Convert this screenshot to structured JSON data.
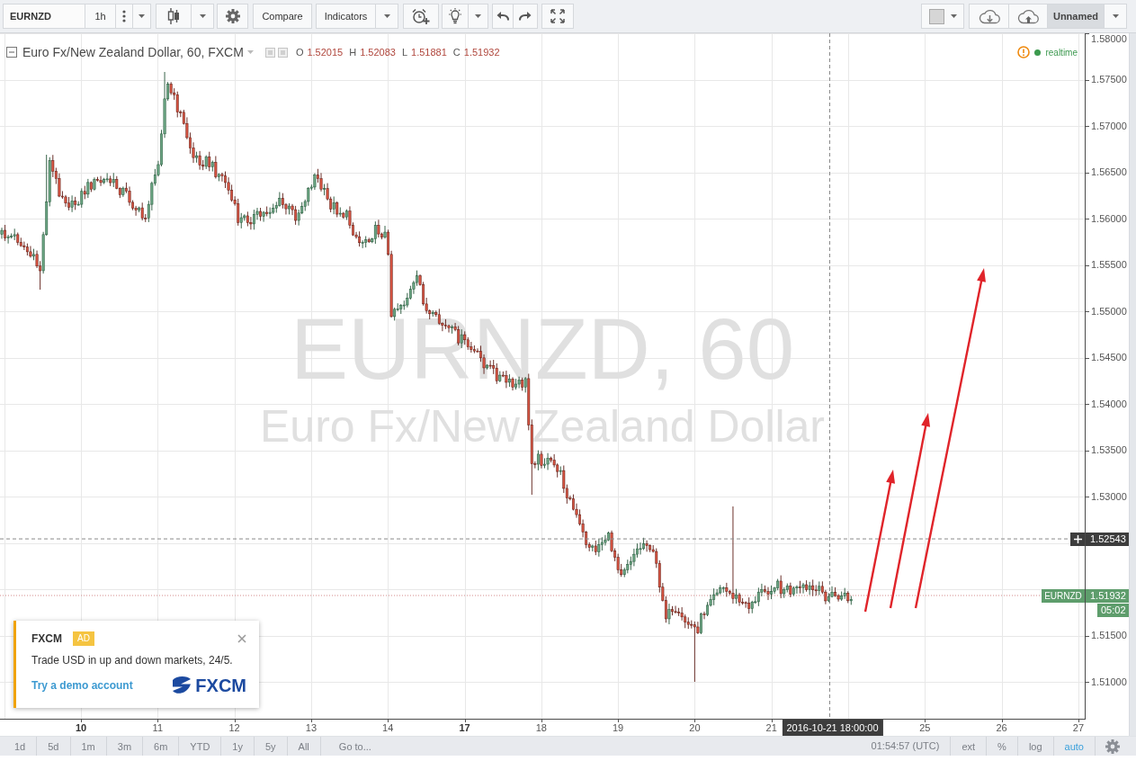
{
  "toolbar": {
    "symbol": "EURNZD",
    "interval": "1h",
    "compare": "Compare",
    "indicators": "Indicators",
    "layout_name": "Unnamed"
  },
  "legend": {
    "title": "Euro Fx/New Zealand Dollar, 60, FXCM",
    "ohlc": [
      {
        "label": "O",
        "value": "1.52015"
      },
      {
        "label": "H",
        "value": "1.52083"
      },
      {
        "label": "L",
        "value": "1.51881"
      },
      {
        "label": "C",
        "value": "1.51932"
      }
    ],
    "status": "realtime"
  },
  "symbol_watermark": {
    "symbol": "EURNZD, 60",
    "description": "Euro Fx/New Zealand Dollar"
  },
  "price_axis": {
    "labels": [
      "1.58000",
      "1.57500",
      "1.57000",
      "1.56500",
      "1.56000",
      "1.55500",
      "1.55000",
      "1.54500",
      "1.54000",
      "1.53500",
      "1.53000",
      "1.51500",
      "1.51000"
    ]
  },
  "crosshair": {
    "price": "1.52543",
    "time": "2016-10-21 18:00:00"
  },
  "last_price": {
    "symbol": "EURNZD",
    "price": "1.51932",
    "countdown": "05:02"
  },
  "time_axis": {
    "labels": [
      {
        "text": "10",
        "bold": true
      },
      {
        "text": "11",
        "bold": false
      },
      {
        "text": "12",
        "bold": false
      },
      {
        "text": "13",
        "bold": false
      },
      {
        "text": "14",
        "bold": false
      },
      {
        "text": "17",
        "bold": true
      },
      {
        "text": "18",
        "bold": false
      },
      {
        "text": "19",
        "bold": false
      },
      {
        "text": "20",
        "bold": false
      },
      {
        "text": "21",
        "bold": false
      },
      {
        "text": "25",
        "bold": false
      },
      {
        "text": "26",
        "bold": false
      },
      {
        "text": "27",
        "bold": false
      }
    ]
  },
  "ad_popup": {
    "brand": "FXCM",
    "tag": "AD",
    "message": "Trade USD in up and down markets, 24/5.",
    "link": "Try a demo account",
    "logo_text": "FXCM"
  },
  "bottom_bar": {
    "ranges": [
      {
        "label": "1d",
        "selected": false
      },
      {
        "label": "5d",
        "selected": false
      },
      {
        "label": "1m",
        "selected": false
      },
      {
        "label": "3m",
        "selected": false
      },
      {
        "label": "6m",
        "selected": false
      },
      {
        "label": "YTD",
        "selected": false
      },
      {
        "label": "1y",
        "selected": false
      },
      {
        "label": "5y",
        "selected": false
      },
      {
        "label": "All",
        "selected": false
      }
    ],
    "goto": "Go to...",
    "clock": "01:54:57 (UTC)",
    "scale_options": [
      {
        "label": "ext",
        "selected": false
      },
      {
        "label": "%",
        "selected": false
      },
      {
        "label": "log",
        "selected": false
      },
      {
        "label": "auto",
        "selected": true
      }
    ]
  }
}
